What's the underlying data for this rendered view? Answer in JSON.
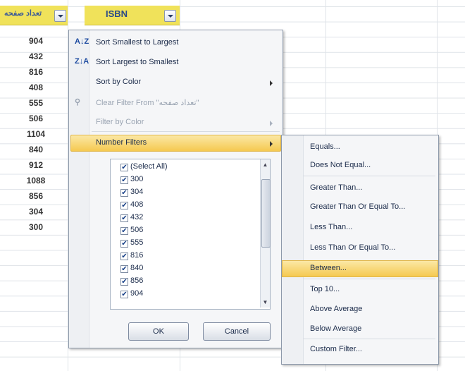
{
  "sheet": {
    "col_headers": [
      "تعداد صفحه",
      "ISBN"
    ],
    "values": [
      "904",
      "432",
      "816",
      "408",
      "555",
      "506",
      "1104",
      "840",
      "912",
      "1088",
      "856",
      "304",
      "300"
    ]
  },
  "menu": {
    "items": [
      {
        "label": "Sort Smallest to Largest",
        "icon": "A↓Z"
      },
      {
        "label": "Sort Largest to Smallest",
        "icon": "Z↓A"
      },
      {
        "label": "Sort by Color"
      },
      {
        "label": "Clear Filter From \"تعداد صفحه\""
      },
      {
        "label": "Filter by Color"
      },
      {
        "label": "Number Filters"
      }
    ],
    "checklist": [
      "(Select All)",
      "300",
      "304",
      "408",
      "432",
      "506",
      "555",
      "816",
      "840",
      "856",
      "904"
    ],
    "ok_label": "OK",
    "cancel_label": "Cancel"
  },
  "submenu": {
    "items": [
      "Equals...",
      "Does Not Equal...",
      "Greater Than...",
      "Greater Than Or Equal To...",
      "Less Than...",
      "Less Than Or Equal To...",
      "Between...",
      "Top 10...",
      "Above Average",
      "Below Average",
      "Custom Filter..."
    ]
  },
  "colors": {
    "header_fill": "#f0e25a",
    "highlight": "#f5c950",
    "menu_bg": "#f5f6f8"
  }
}
